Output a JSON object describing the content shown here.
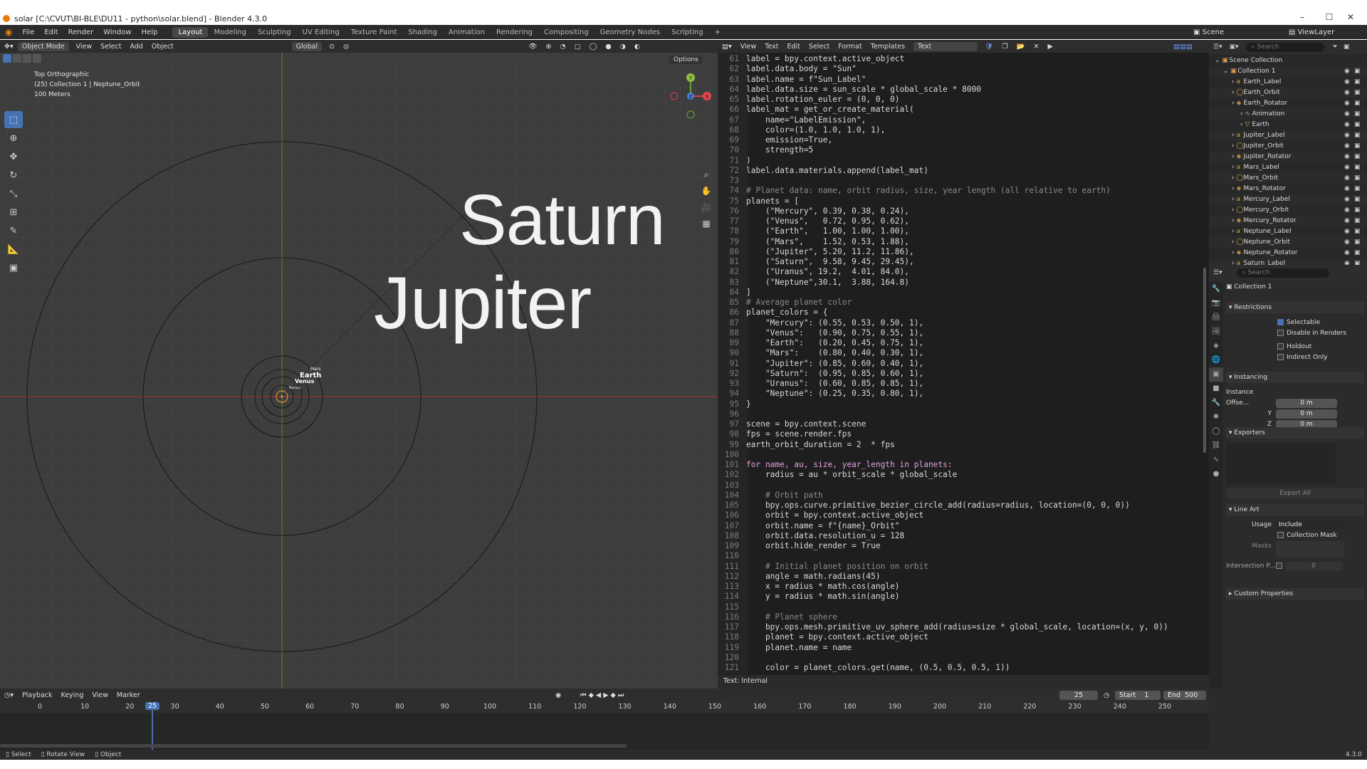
{
  "window": {
    "title": "solar [C:\\CVUT\\BI-BLE\\DU11 - python\\solar.blend] - Blender 4.3.0"
  },
  "menu": [
    "File",
    "Edit",
    "Render",
    "Window",
    "Help"
  ],
  "workspaces": [
    "Layout",
    "Modeling",
    "Sculpting",
    "UV Editing",
    "Texture Paint",
    "Shading",
    "Animation",
    "Rendering",
    "Compositing",
    "Geometry Nodes",
    "Scripting"
  ],
  "top_right": {
    "scene": "Scene",
    "view_layer": "ViewLayer"
  },
  "viewport": {
    "mode": "Object Mode",
    "menus": [
      "View",
      "Select",
      "Add",
      "Object"
    ],
    "transform": "Global",
    "options": "Options",
    "info_view": "Top Orthographic",
    "info_collection": "(25) Collection 1 | Neptune_Orbit",
    "info_scale": "100 Meters",
    "labels": {
      "saturn": "Saturn",
      "jupiter": "Jupiter",
      "mars": "Mars",
      "earth": "Earth",
      "venus": "Venus",
      "mercury": "Mercury"
    },
    "gizmo_axes": {
      "x": "X",
      "y": "Y",
      "z": "Z"
    }
  },
  "text_editor": {
    "menus": [
      "View",
      "Text",
      "Edit",
      "Select",
      "Format",
      "Templates"
    ],
    "text_name": "Text",
    "footer": "Text: Internal",
    "lines": [
      {
        "n": "61",
        "c": "label = bpy.context.active_object"
      },
      {
        "n": "62",
        "c": "label.data.body = \"Sun\""
      },
      {
        "n": "63",
        "c": "label.name = f\"Sun_Label\""
      },
      {
        "n": "64",
        "c": "label.data.size = sun_scale * global_scale * 8000"
      },
      {
        "n": "65",
        "c": "label.rotation_euler = (0, 0, 0)"
      },
      {
        "n": "66",
        "c": "label_mat = get_or_create_material("
      },
      {
        "n": "67",
        "c": "    name=\"LabelEmission\","
      },
      {
        "n": "68",
        "c": "    color=(1.0, 1.0, 1.0, 1),"
      },
      {
        "n": "69",
        "c": "    emission=True,"
      },
      {
        "n": "70",
        "c": "    strength=5"
      },
      {
        "n": "71",
        "c": ")"
      },
      {
        "n": "72",
        "c": "label.data.materials.append(label_mat)"
      },
      {
        "n": "73",
        "c": ""
      },
      {
        "n": "74",
        "c": "# Planet data: name, orbit radius, size, year length (all relative to earth)"
      },
      {
        "n": "75",
        "c": "planets = ["
      },
      {
        "n": "76",
        "c": "    (\"Mercury\", 0.39, 0.38, 0.24),"
      },
      {
        "n": "77",
        "c": "    (\"Venus\",   0.72, 0.95, 0.62),"
      },
      {
        "n": "78",
        "c": "    (\"Earth\",   1.00, 1.00, 1.00),"
      },
      {
        "n": "79",
        "c": "    (\"Mars\",    1.52, 0.53, 1.88),"
      },
      {
        "n": "80",
        "c": "    (\"Jupiter\", 5.20, 11.2, 11.86),"
      },
      {
        "n": "81",
        "c": "    (\"Saturn\",  9.58, 9.45, 29.45),"
      },
      {
        "n": "82",
        "c": "    (\"Uranus\", 19.2,  4.01, 84.0),"
      },
      {
        "n": "83",
        "c": "    (\"Neptune\",30.1,  3.88, 164.8)"
      },
      {
        "n": "84",
        "c": "]"
      },
      {
        "n": "85",
        "c": "# Average planet color"
      },
      {
        "n": "86",
        "c": "planet_colors = {"
      },
      {
        "n": "87",
        "c": "    \"Mercury\": (0.55, 0.53, 0.50, 1),"
      },
      {
        "n": "88",
        "c": "    \"Venus\":   (0.90, 0.75, 0.55, 1),"
      },
      {
        "n": "89",
        "c": "    \"Earth\":   (0.20, 0.45, 0.75, 1),"
      },
      {
        "n": "90",
        "c": "    \"Mars\":    (0.80, 0.40, 0.30, 1),"
      },
      {
        "n": "91",
        "c": "    \"Jupiter\": (0.85, 0.60, 0.40, 1),"
      },
      {
        "n": "92",
        "c": "    \"Saturn\":  (0.95, 0.85, 0.60, 1),"
      },
      {
        "n": "93",
        "c": "    \"Uranus\":  (0.60, 0.85, 0.85, 1),"
      },
      {
        "n": "94",
        "c": "    \"Neptune\": (0.25, 0.35, 0.80, 1),"
      },
      {
        "n": "95",
        "c": "}"
      },
      {
        "n": "96",
        "c": ""
      },
      {
        "n": "97",
        "c": "scene = bpy.context.scene"
      },
      {
        "n": "98",
        "c": "fps = scene.render.fps"
      },
      {
        "n": "99",
        "c": "earth_orbit_duration = 2  * fps"
      },
      {
        "n": "100",
        "c": ""
      },
      {
        "n": "101",
        "c": "for name, au, size, year_length in planets:"
      },
      {
        "n": "102",
        "c": "    radius = au * orbit_scale * global_scale"
      },
      {
        "n": "103",
        "c": ""
      },
      {
        "n": "104",
        "c": "    # Orbit path"
      },
      {
        "n": "105",
        "c": "    bpy.ops.curve.primitive_bezier_circle_add(radius=radius, location=(0, 0, 0))"
      },
      {
        "n": "106",
        "c": "    orbit = bpy.context.active_object"
      },
      {
        "n": "107",
        "c": "    orbit.name = f\"{name}_Orbit\""
      },
      {
        "n": "108",
        "c": "    orbit.data.resolution_u = 128"
      },
      {
        "n": "109",
        "c": "    orbit.hide_render = True"
      },
      {
        "n": "110",
        "c": ""
      },
      {
        "n": "111",
        "c": "    # Initial planet position on orbit"
      },
      {
        "n": "112",
        "c": "    angle = math.radians(45)"
      },
      {
        "n": "113",
        "c": "    x = radius * math.cos(angle)"
      },
      {
        "n": "114",
        "c": "    y = radius * math.sin(angle)"
      },
      {
        "n": "115",
        "c": ""
      },
      {
        "n": "116",
        "c": "    # Planet sphere"
      },
      {
        "n": "117",
        "c": "    bpy.ops.mesh.primitive_uv_sphere_add(radius=size * global_scale, location=(x, y, 0))"
      },
      {
        "n": "118",
        "c": "    planet = bpy.context.active_object"
      },
      {
        "n": "119",
        "c": "    planet.name = name"
      },
      {
        "n": "120",
        "c": ""
      },
      {
        "n": "121",
        "c": "    color = planet_colors.get(name, (0.5, 0.5, 0.5, 1))"
      }
    ]
  },
  "outliner": {
    "search_placeholder": "Search",
    "items": [
      {
        "label": "Scene Collection"
      },
      {
        "label": "Collection 1"
      },
      {
        "label": "Earth_Label"
      },
      {
        "label": "Earth_Orbit"
      },
      {
        "label": "Earth_Rotator"
      },
      {
        "label": "Animation"
      },
      {
        "label": "Earth"
      },
      {
        "label": "Jupiter_Label"
      },
      {
        "label": "Jupiter_Orbit"
      },
      {
        "label": "Jupiter_Rotator"
      },
      {
        "label": "Mars_Label"
      },
      {
        "label": "Mars_Orbit"
      },
      {
        "label": "Mars_Rotator"
      },
      {
        "label": "Mercury_Label"
      },
      {
        "label": "Mercury_Orbit"
      },
      {
        "label": "Mercury_Rotator"
      },
      {
        "label": "Neptune_Label"
      },
      {
        "label": "Neptune_Orbit"
      },
      {
        "label": "Neptune_Rotator"
      },
      {
        "label": "Saturn_Label"
      }
    ]
  },
  "properties": {
    "search_placeholder": "Search",
    "collection_name": "Collection 1",
    "restrictions_title": "Restrictions",
    "selectable": "Selectable",
    "disable_renders": "Disable in Renders",
    "holdout": "Holdout",
    "indirect_only": "Indirect Only",
    "instancing_title": "Instancing",
    "instance_offset_label": "Instance Offse...",
    "y_label": "Y",
    "z_label": "Z",
    "offset_x": "0 m",
    "offset_y": "0 m",
    "offset_z": "0 m",
    "exporters_title": "Exporters",
    "export_all": "Export All",
    "line_art_title": "Line Art",
    "usage_label": "Usage",
    "usage_value": "Include",
    "collection_mask": "Collection Mask",
    "masks_label": "Masks",
    "intersection_label": "Intersection P...",
    "intersection_value": "0",
    "custom_props": "Custom Properties"
  },
  "timeline": {
    "menus": [
      "Playback",
      "Keying",
      "View",
      "Marker"
    ],
    "current_frame": "25",
    "start_label": "Start",
    "start": "1",
    "end_label": "End",
    "end": "500",
    "ticks": [
      "0",
      "10",
      "20",
      "30",
      "40",
      "50",
      "60",
      "70",
      "80",
      "90",
      "100",
      "110",
      "120",
      "130",
      "140",
      "150",
      "160",
      "170",
      "180",
      "190",
      "200",
      "210",
      "220",
      "230",
      "240",
      "250"
    ]
  },
  "status_bar": {
    "select": "Select",
    "rotate": "Rotate View",
    "object": "Object",
    "version": "4.3.0"
  }
}
